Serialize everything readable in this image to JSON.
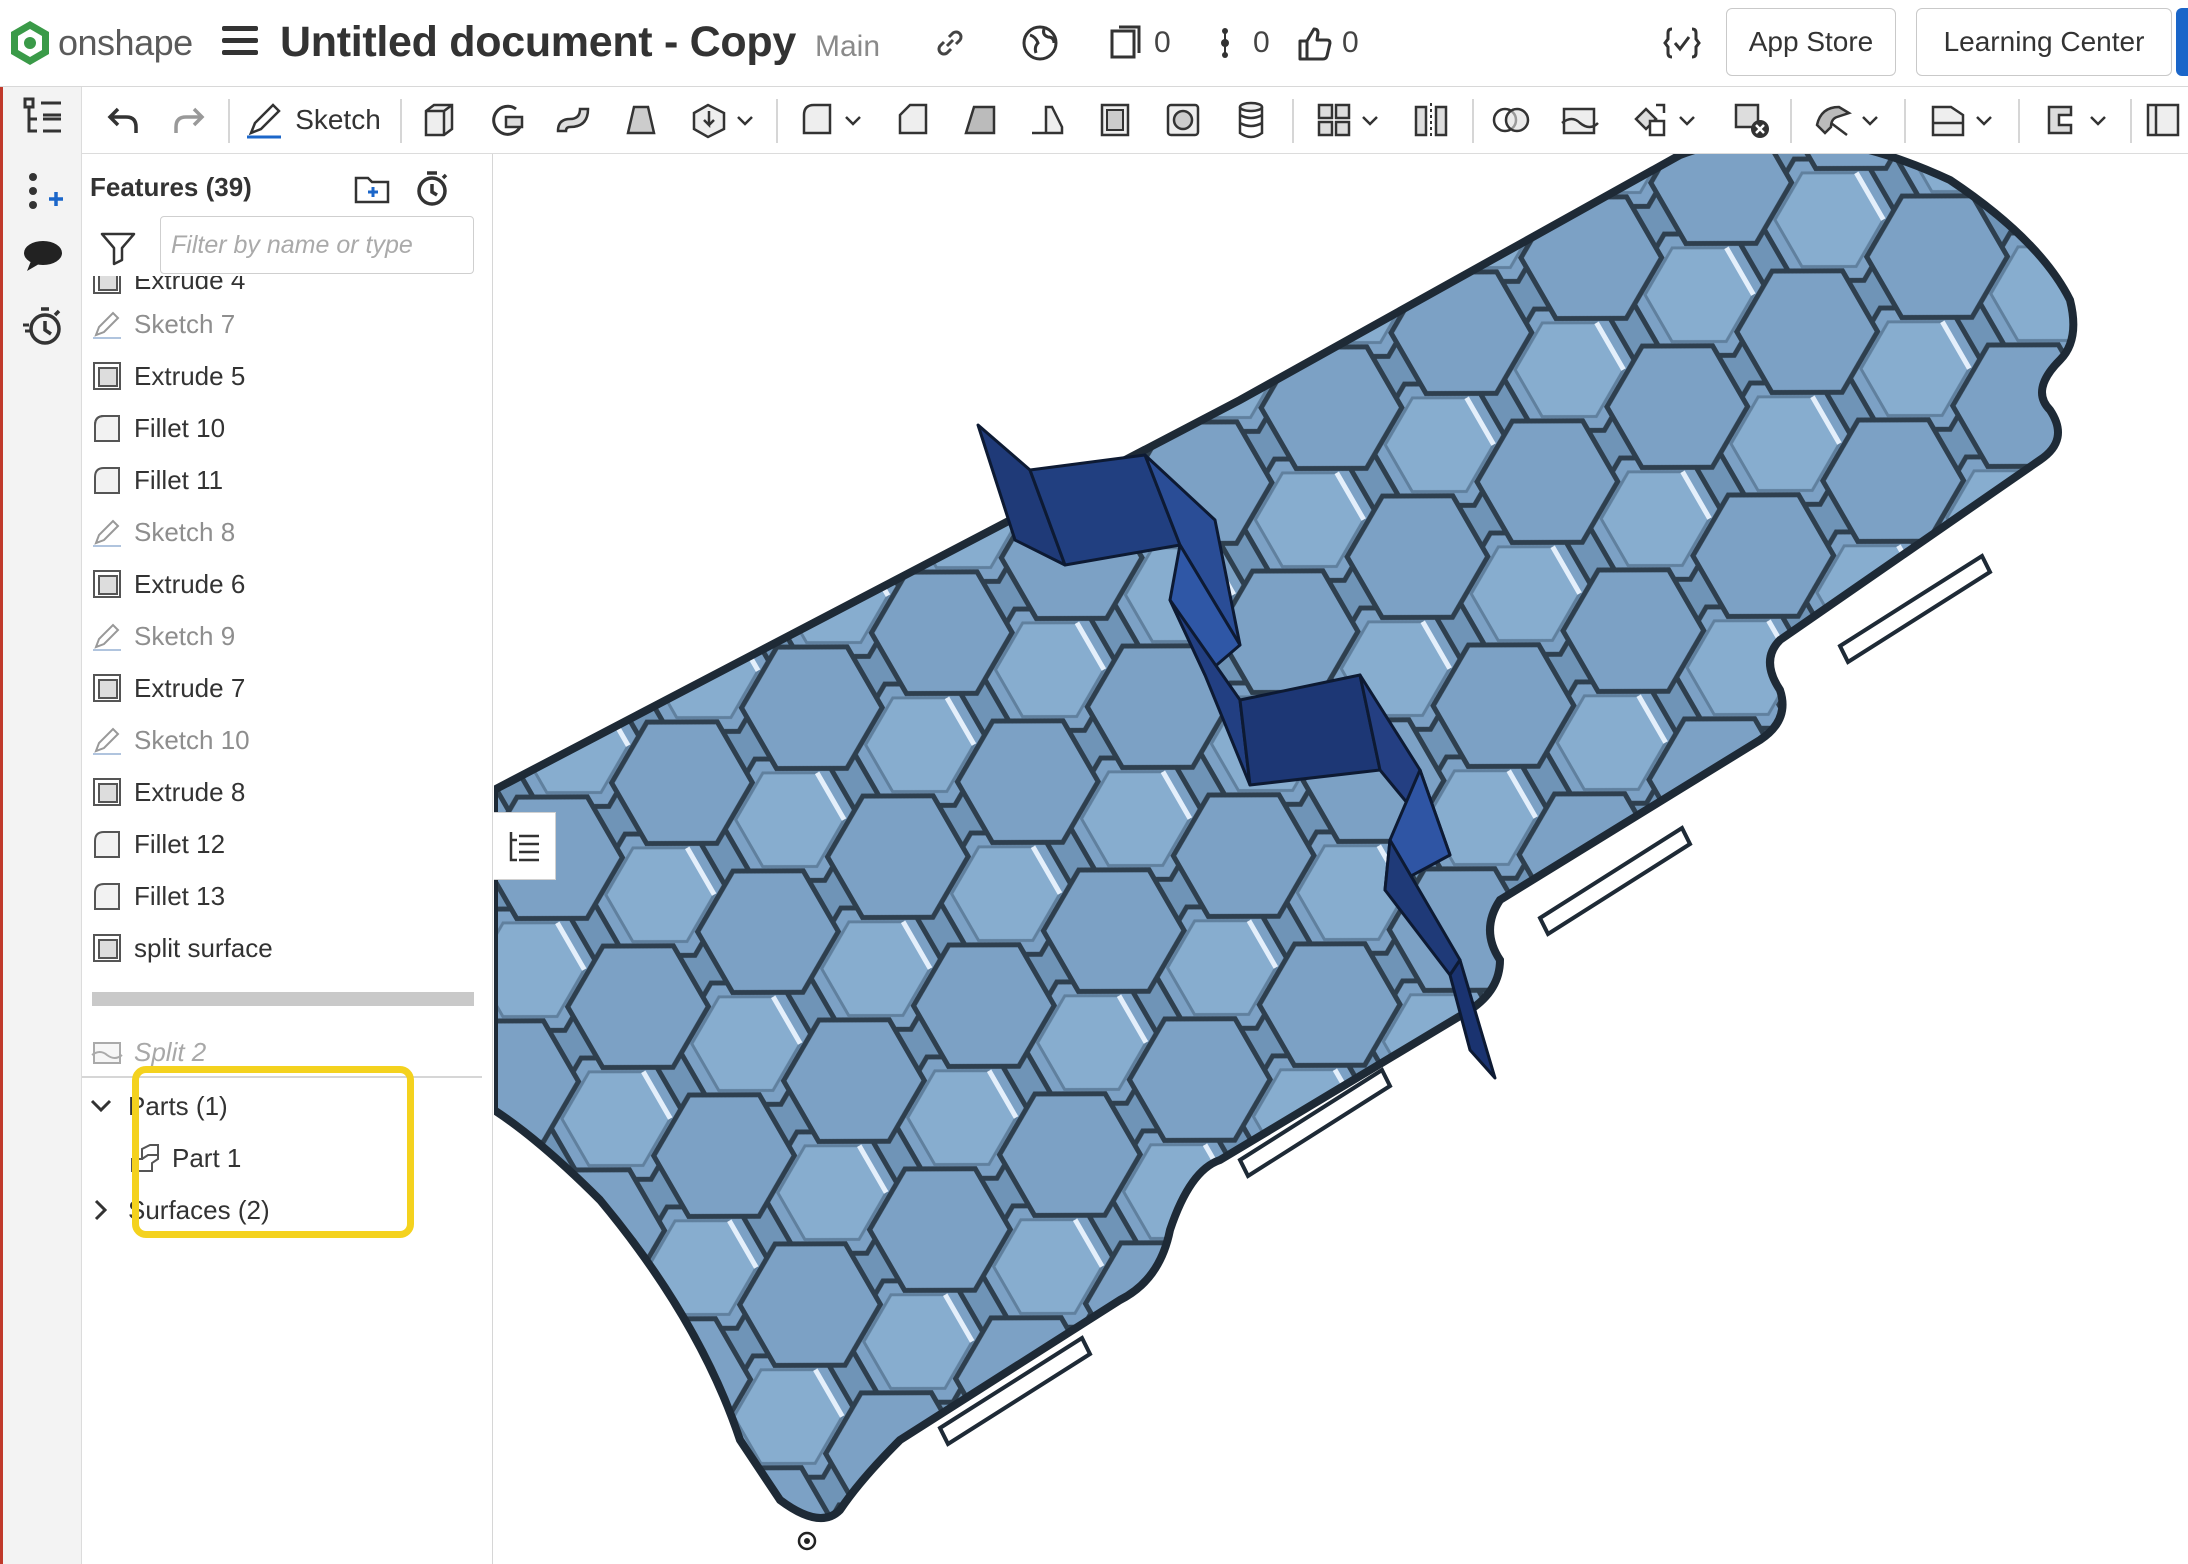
{
  "header": {
    "brand": "onshape",
    "document_title": "Untitled document - Copy",
    "branch": "Main",
    "versions_count": "0",
    "tasks_count": "0",
    "likes_count": "0",
    "app_store": "App Store",
    "learning_center": "Learning Center"
  },
  "toolbar": {
    "sketch_label": "Sketch"
  },
  "panel": {
    "title": "Features (39)",
    "filter_placeholder": "Filter by name or type",
    "features": [
      {
        "label": "Extrude 4",
        "type": "extrude"
      },
      {
        "label": "Sketch 7",
        "type": "sketch"
      },
      {
        "label": "Extrude 5",
        "type": "extrude"
      },
      {
        "label": "Fillet 10",
        "type": "fillet"
      },
      {
        "label": "Fillet 11",
        "type": "fillet"
      },
      {
        "label": "Sketch 8",
        "type": "sketch"
      },
      {
        "label": "Extrude 6",
        "type": "extrude"
      },
      {
        "label": "Sketch 9",
        "type": "sketch"
      },
      {
        "label": "Extrude 7",
        "type": "extrude"
      },
      {
        "label": "Sketch 10",
        "type": "sketch"
      },
      {
        "label": "Extrude 8",
        "type": "extrude"
      },
      {
        "label": "Fillet 12",
        "type": "fillet"
      },
      {
        "label": "Fillet 13",
        "type": "fillet"
      },
      {
        "label": "split surface",
        "type": "extrude"
      },
      {
        "label": "Split 2",
        "type": "split"
      }
    ],
    "parts_group": "Parts (1)",
    "part_item": "Part 1",
    "surfaces_group": "Surfaces (2)"
  },
  "colors": {
    "part": "#7ea2c4",
    "part_edge": "#1e2a36",
    "surface": "#1f3a78",
    "highlight": "#f4d21e",
    "brand": "#3a9a48"
  }
}
